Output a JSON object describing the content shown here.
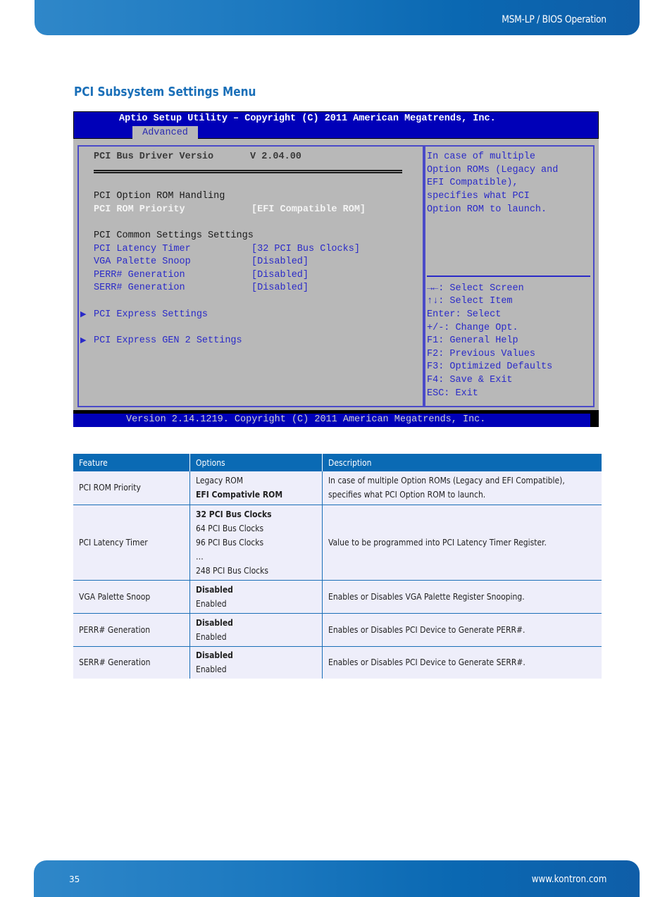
{
  "header": {
    "title": "MSM-LP / BIOS Operation"
  },
  "section": {
    "title": "PCI Subsystem Settings Menu"
  },
  "bios": {
    "title": "Aptio Setup Utility – Copyright (C) 2011 American Megatrends, Inc.",
    "active_tab": "Advanced",
    "driver_version_label": "PCI Bus Driver Versio",
    "driver_version_value": "V 2.04.00",
    "option_rom_heading": "PCI Option ROM Handling",
    "common_heading": "PCI Common Settings Settings",
    "settings": [
      {
        "label": "PCI ROM Priority",
        "value": "[EFI Compatible ROM]",
        "selected": true
      },
      {
        "label": "PCI Latency Timer",
        "value": "[32 PCI Bus Clocks]"
      },
      {
        "label": "VGA Palette Snoop",
        "value": "[Disabled]"
      },
      {
        "label": "PERR# Generation",
        "value": "[Disabled]"
      },
      {
        "label": "SERR# Generation",
        "value": "[Disabled]"
      }
    ],
    "submenus": [
      {
        "label": "PCI Express Settings"
      },
      {
        "label": "PCI Express GEN 2 Settings"
      }
    ],
    "help_text": [
      "In case of multiple",
      "Option ROMs (Legacy and",
      "EFI Compatible),",
      "specifies what PCI",
      "Option ROM to launch."
    ],
    "key_help": [
      "→←: Select Screen",
      "↑↓: Select Item",
      "Enter: Select",
      "+/-: Change Opt.",
      "F1: General Help",
      "F2: Previous Values",
      "F3: Optimized Defaults",
      "F4: Save & Exit",
      "ESC: Exit"
    ],
    "version_line": "Version 2.14.1219. Copyright (C) 2011 American Megatrends, Inc."
  },
  "table": {
    "headers": [
      "Feature",
      "Options",
      "Description"
    ],
    "rows": [
      {
        "feature": "PCI ROM Priority",
        "options": [
          "Legacy ROM",
          "EFI Compativle ROM"
        ],
        "default_index": 1,
        "description": "In case of multiple Option ROMs (Legacy and EFI Compatible), specifies what PCI Option ROM to launch."
      },
      {
        "feature": "PCI Latency Timer",
        "options": [
          "32 PCI Bus Clocks",
          "64 PCI Bus Clocks",
          "96 PCI Bus Clocks",
          "…",
          "248 PCI Bus Clocks"
        ],
        "default_index": 0,
        "description": "Value to be programmed into PCI Latency Timer Register."
      },
      {
        "feature": "VGA Palette Snoop",
        "options": [
          "Disabled",
          "Enabled"
        ],
        "default_index": 0,
        "description": "Enables or Disables VGA Palette Register Snooping."
      },
      {
        "feature": "PERR# Generation",
        "options": [
          "Disabled",
          "Enabled"
        ],
        "default_index": 0,
        "description": "Enables or Disables PCI Device to Generate PERR#."
      },
      {
        "feature": "SERR# Generation",
        "options": [
          "Disabled",
          "Enabled"
        ],
        "default_index": 0,
        "description": "Enables or Disables PCI Device to Generate SERR#."
      }
    ]
  },
  "footer": {
    "page_number": "35",
    "url": "www.kontron.com"
  }
}
